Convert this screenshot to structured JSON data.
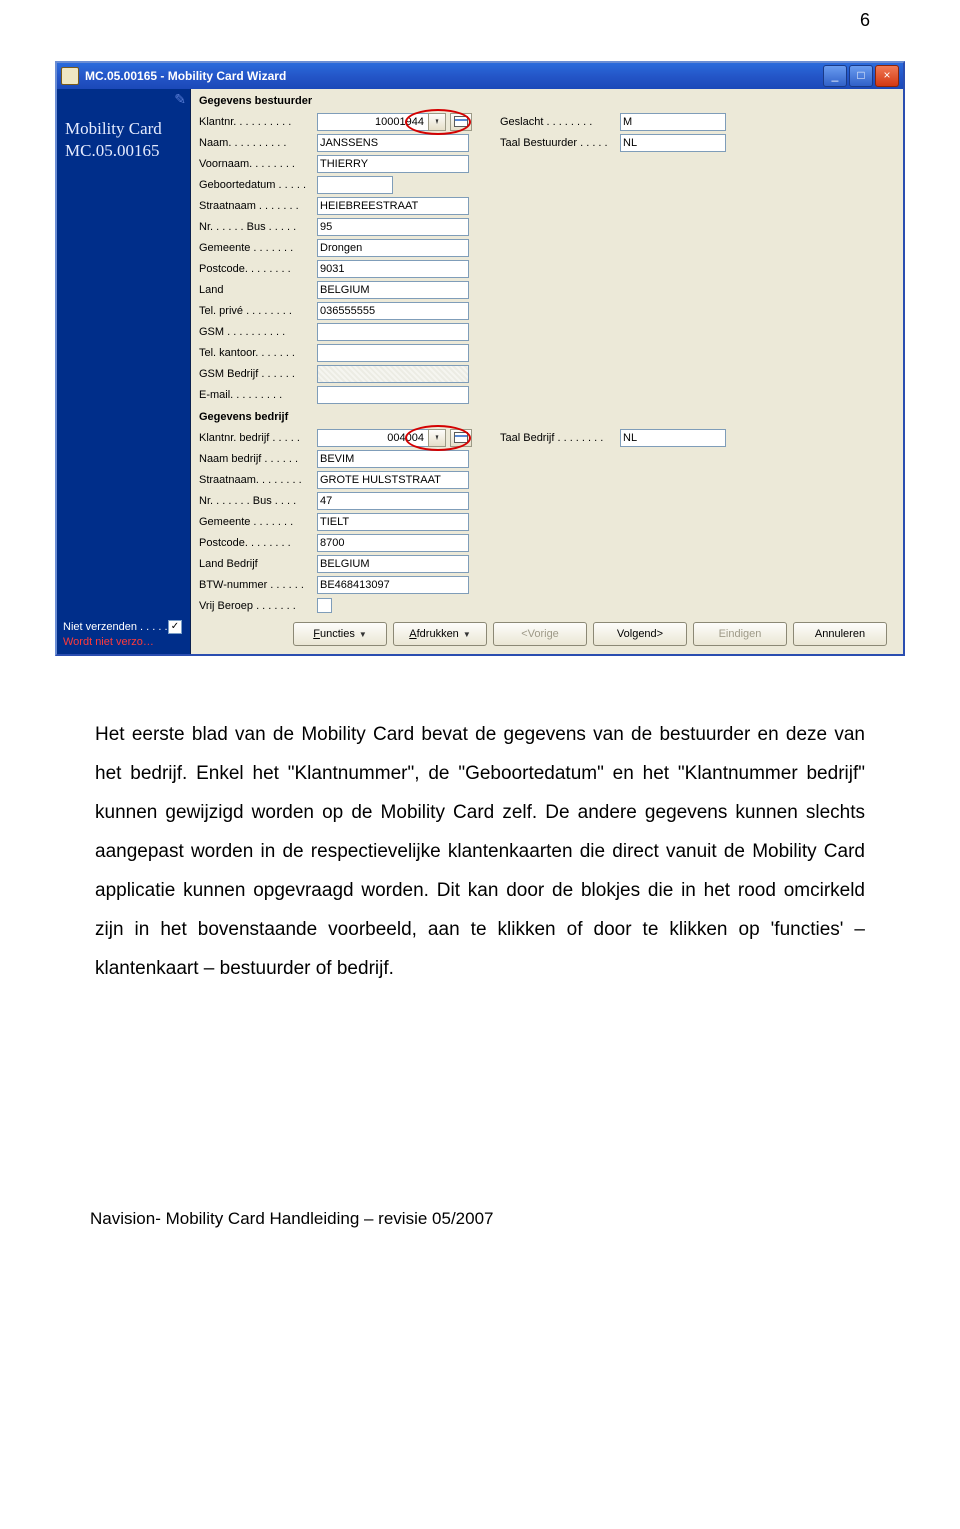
{
  "page_number": "6",
  "window": {
    "title": "MC.05.00165 - Mobility Card Wizard"
  },
  "sidebar": {
    "title": "Mobility Card",
    "subtitle": "MC.05.00165",
    "niet_ver_label": "Niet verzenden .  .  .  .  .",
    "niet_ver_check": "✓",
    "warn": "Wordt niet verzo…"
  },
  "section1": "Gegevens bestuurder",
  "section2": "Gegevens bedrijf",
  "driver": {
    "klantnr_lbl": "Klantnr. .  .  .  .  .  .  .  .  .",
    "klantnr": "10001944",
    "naam_lbl": "Naam.  .  .  .  .  .  .  .  .  .",
    "naam": "JANSSENS",
    "voornaam_lbl": "Voornaam.  .  .  .  .  .  .  .",
    "voornaam": "THIERRY",
    "geboorte_lbl": "Geboortedatum .  .  .  .  .",
    "geboorte": "",
    "straat_lbl": "Straatnaam .  .  .  .  .  .  .",
    "straat": "HEIEBREESTRAAT",
    "nrbus_lbl": "Nr. .  .  .  .  . Bus .  .  .  .  .",
    "nrbus": "95",
    "gemeente_lbl": "Gemeente  .  .  .  .  .  .  .",
    "gemeente": "Drongen",
    "postcode_lbl": "Postcode.  .  .  .  .  .  .  .",
    "postcode": "9031",
    "land_lbl": "Land",
    "land": "BELGIUM",
    "telprive_lbl": "Tel. privé .  .  .  .  .  .  .  .",
    "telprive": "036555555",
    "gsm_lbl": "GSM .  .  .  .  .  .  .  .  .  .",
    "gsm": "",
    "telkantoor_lbl": "Tel. kantoor. .  .  .  .  .  .",
    "telkantoor": "",
    "gsmb_lbl": "GSM Bedrijf .  .  .  .  .  .",
    "gsmb": "",
    "email_lbl": "E-mail.  .  .  .  .  .  .  .  .",
    "email": ""
  },
  "driver_right": {
    "geslacht_lbl": "Geslacht  .  .  .  .  .  .  .  .",
    "geslacht": "M",
    "taal_lbl": "Taal Bestuurder .  .  .  .  .",
    "taal": "NL"
  },
  "company": {
    "klantnr_lbl": "Klantnr. bedrijf .  .  .  .  .",
    "klantnr": "004004",
    "naamb_lbl": "Naam bedrijf  .  .  .  .  .  .",
    "naamb": "BEVIM",
    "straat_lbl": "Straatnaam.  .  .  .  .  .  .  .",
    "straat": "GROTE HULSTSTRAAT",
    "nrbus_lbl": "Nr. .  .  .  .  .  . Bus .  .  .  .",
    "nrbus": "47",
    "gemeente_lbl": "Gemeente  .  .  .  .  .  .  .",
    "gemeente": "TIELT",
    "postcode_lbl": "Postcode.  .  .  .  .  .  .  .",
    "postcode": "8700",
    "landb_lbl": "Land Bedrijf",
    "landb": "BELGIUM",
    "btw_lbl": "BTW-nummer .  .  .  .  .  .",
    "btw": "BE468413097",
    "vrij_lbl": "Vrij Beroep .  .  .  .  .  .  ."
  },
  "company_right": {
    "taal_lbl": "Taal Bedrijf .  .  .  .  .  .  .  .",
    "taal": "NL"
  },
  "buttons": {
    "functies": "Functies",
    "afdrukken": "Afdrukken",
    "vorige": "<Vorige",
    "volgend": "Volgend>",
    "eindigen": "Eindigen",
    "annuleren": "Annuleren"
  },
  "body_text": "Het eerste blad van de Mobility Card bevat de gegevens van de bestuurder en deze van het bedrijf. Enkel het \"Klantnummer\", de \"Geboortedatum\" en het \"Klantnummer bedrijf\" kunnen gewijzigd worden op de Mobility Card zelf. De andere gegevens kunnen slechts aangepast worden in de respectievelijke klantenkaarten die direct vanuit de Mobility Card applicatie kunnen opgevraagd worden. Dit kan door de blokjes die in het rood omcirkeld zijn in het bovenstaande voorbeeld, aan te klikken of door te klikken op 'functies' – klantenkaart – bestuurder of bedrijf.",
  "footer": "Navision- Mobility Card Handleiding – revisie 05/2007"
}
